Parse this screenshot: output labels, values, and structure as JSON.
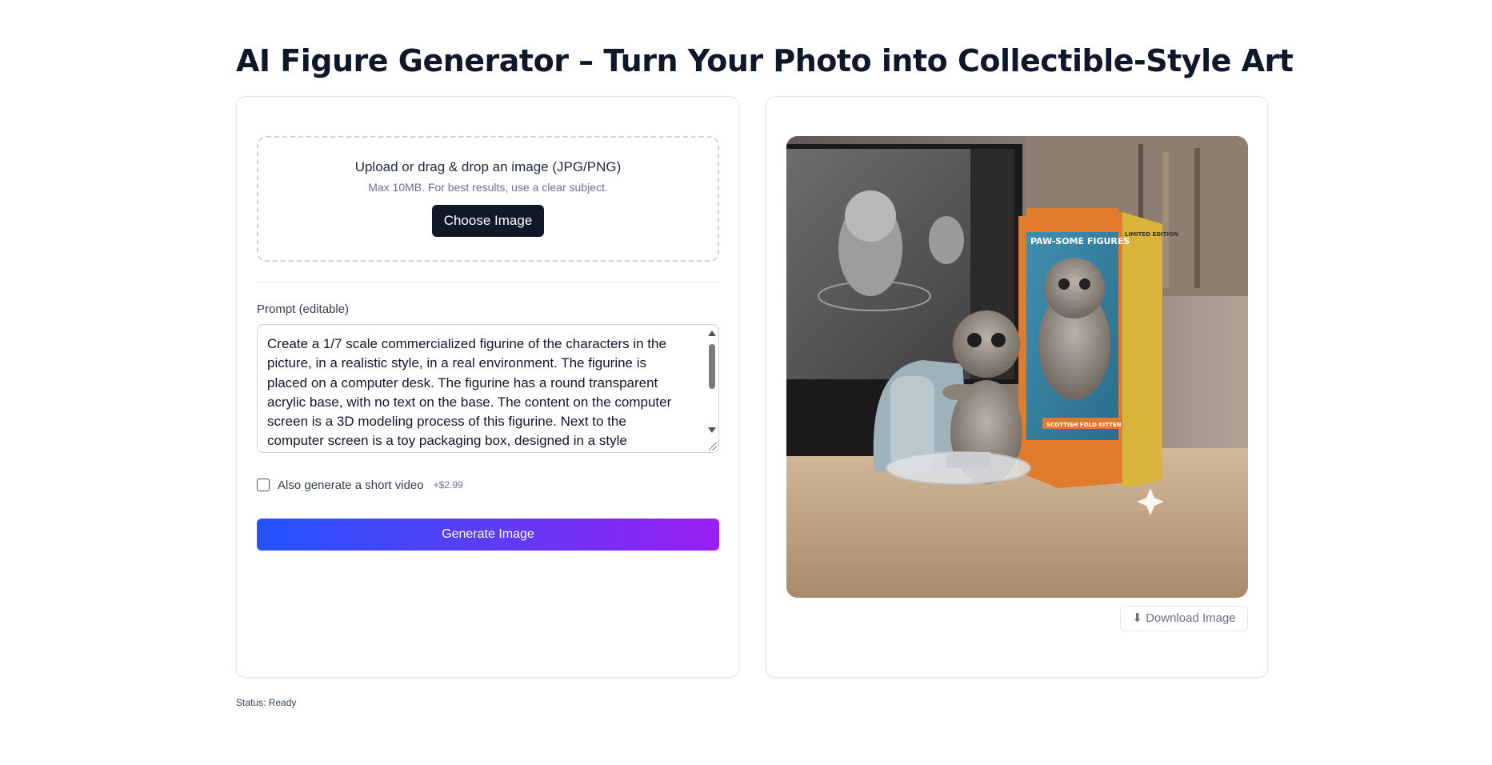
{
  "page": {
    "title": "AI Figure Generator – Turn Your Photo into Collectible-Style Art"
  },
  "upload": {
    "title": "Upload or drag & drop an image (JPG/PNG)",
    "subtitle": "Max 10MB. For best results, use a clear subject.",
    "choose_label": "Choose Image"
  },
  "prompt": {
    "label": "Prompt (editable)",
    "lines": [
      "Create a 1/7 scale commercialized figurine of the characters in the",
      "picture, in a realistic style, in a real environment. The figurine is",
      "placed on a computer desk. The figurine has a round transparent",
      "acrylic base, with no text on the base. The content on the computer",
      "screen is a 3D modeling process of this figurine. Next to the",
      "computer screen is a toy packaging box, designed in a style"
    ]
  },
  "video_option": {
    "label": "Also generate a short video",
    "price": "+$2.99",
    "checked": false
  },
  "generate": {
    "label": "Generate Image",
    "gradient": [
      "#2453ff",
      "#9a1ff5"
    ]
  },
  "result": {
    "image_alt": "Scottish fold kitten figurine on a desk next to a monitor and a toy box",
    "box_brand": "PAW-SOME FIGURES",
    "box_tag": "LIMITED EDITION",
    "box_product": "SCOTTISH FOLD KITTEN",
    "download_label": "⬇ Download Image"
  },
  "status": {
    "text": "Status: Ready"
  }
}
